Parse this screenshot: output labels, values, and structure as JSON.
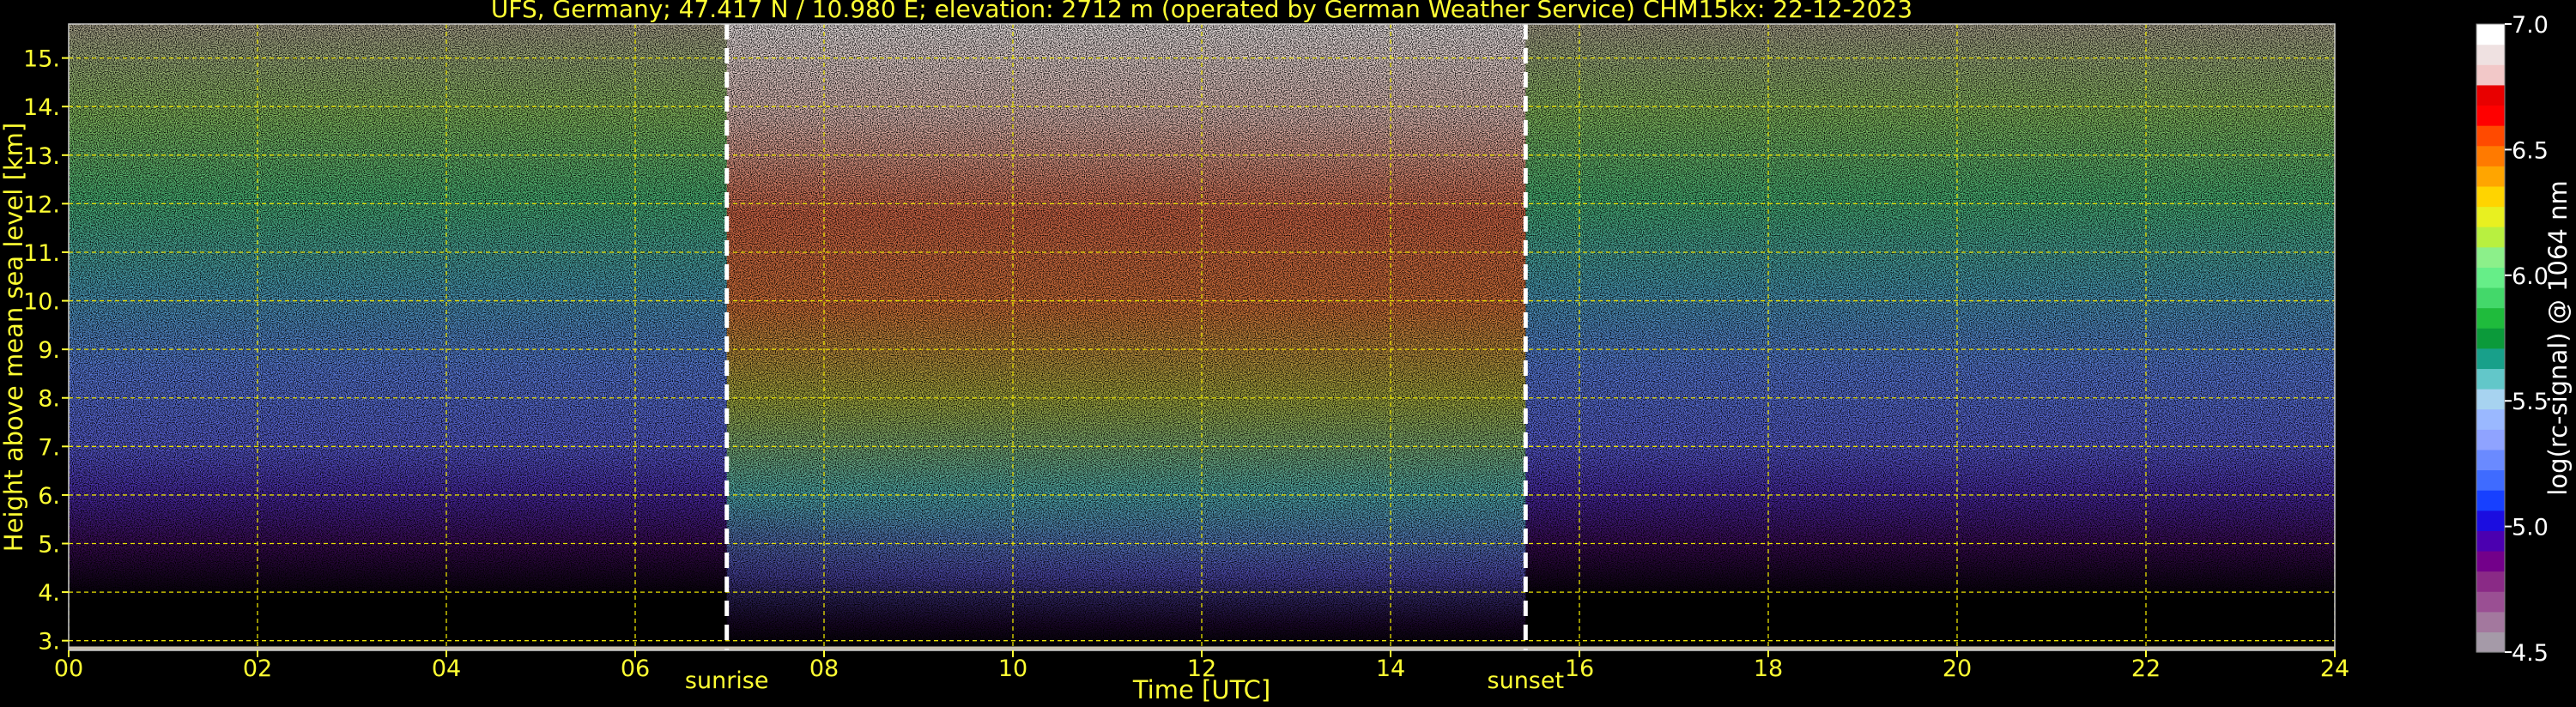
{
  "chart_data": {
    "type": "heatmap",
    "title": "UFS, Germany; 47.417 N / 10.980 E; elevation: 2712 m  (operated by German Weather Service)    CHM15kx: 22-12-2023",
    "xlabel": "Time [UTC]",
    "ylabel": "Height above mean sea level [km]",
    "xlim": [
      0,
      24
    ],
    "ylim": [
      2.8,
      15.7
    ],
    "x_ticks": [
      "00",
      "02",
      "04",
      "06",
      "08",
      "10",
      "12",
      "14",
      "16",
      "18",
      "20",
      "22",
      "24"
    ],
    "y_ticks": [
      "3.",
      "4.",
      "5.",
      "6.",
      "7.",
      "8.",
      "9.",
      "10.",
      "11.",
      "12.",
      "13.",
      "14.",
      "15."
    ],
    "grid": true,
    "markers": [
      {
        "label": "sunrise",
        "x": 6.97
      },
      {
        "label": "sunset",
        "x": 15.43
      }
    ],
    "colorbar": {
      "label": "log(rc-signal) @ 1064 nm",
      "range": [
        4.5,
        7.0
      ],
      "ticks": [
        "4.5",
        "5.0",
        "5.5",
        "6.0",
        "6.5",
        "7.0"
      ],
      "colors": [
        "#a59aa8",
        "#a3789e",
        "#9a4f93",
        "#8a2a86",
        "#73008a",
        "#4b00b0",
        "#1b0de0",
        "#1740ff",
        "#3f6bff",
        "#6a8aff",
        "#8fa3ff",
        "#9ab8ff",
        "#a7d3f0",
        "#62c7c9",
        "#18a08a",
        "#0b9a3a",
        "#1fbb3c",
        "#43d86a",
        "#66ee88",
        "#8cf08a",
        "#b8f040",
        "#e8f020",
        "#ffd400",
        "#ffa500",
        "#ff7a00",
        "#ff4a00",
        "#ff0000",
        "#e80000",
        "#f2c8c8",
        "#efe1e1",
        "#ffffff"
      ]
    }
  }
}
